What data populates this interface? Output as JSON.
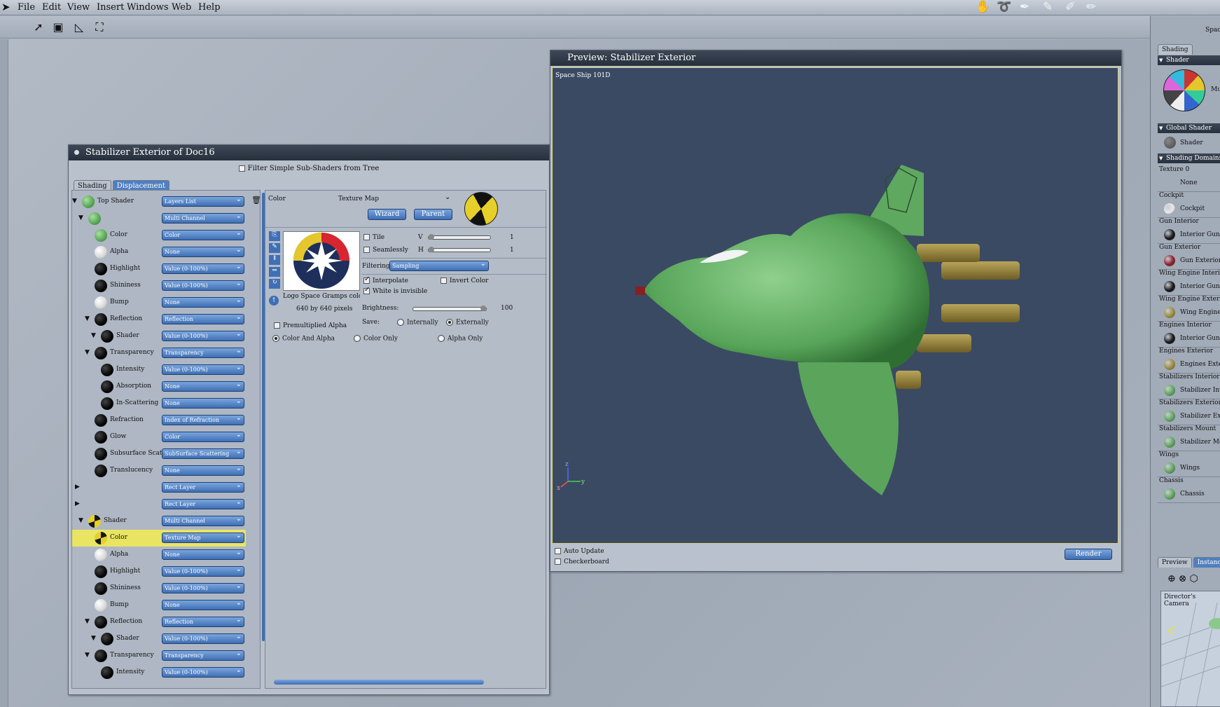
{
  "menu": {
    "logo_icon": "app-logo-icon",
    "items": [
      "File",
      "Edit",
      "View",
      "Insert",
      "Windows",
      "Web",
      "Help"
    ]
  },
  "toolbar": {
    "tools": [
      "arrow-select-icon",
      "box-select-icon",
      "polygon-select-icon",
      "frame-select-icon"
    ]
  },
  "top_right_label": "Spac",
  "shader_window": {
    "title": "Stabilizer Exterior of Doc16",
    "filter_label": "Filter Simple Sub-Shaders from Tree",
    "tabs": [
      "Shading",
      "Displacement"
    ],
    "tree": [
      {
        "label": "Top Shader",
        "value": "Layers List",
        "sphere": "green",
        "indent": 0
      },
      {
        "label": "",
        "value": "Multi Channel",
        "sphere": "green",
        "indent": 1
      },
      {
        "label": "Color",
        "value": "Color",
        "sphere": "green",
        "indent": 2
      },
      {
        "label": "Alpha",
        "value": "None",
        "sphere": "white",
        "indent": 2
      },
      {
        "label": "Highlight",
        "value": "Value (0-100%)",
        "sphere": "black",
        "indent": 2
      },
      {
        "label": "Shininess",
        "value": "Value (0-100%)",
        "sphere": "black",
        "indent": 2
      },
      {
        "label": "Bump",
        "value": "None",
        "sphere": "white",
        "indent": 2
      },
      {
        "label": "Reflection",
        "value": "Reflection",
        "sphere": "black",
        "indent": 2
      },
      {
        "label": "Shader",
        "value": "Value (0-100%)",
        "sphere": "black",
        "indent": 3
      },
      {
        "label": "Transparency",
        "value": "Transparency",
        "sphere": "black",
        "indent": 2
      },
      {
        "label": "Intensity",
        "value": "Value (0-100%)",
        "sphere": "black",
        "indent": 3
      },
      {
        "label": "Absorption",
        "value": "None",
        "sphere": "black",
        "indent": 3
      },
      {
        "label": "In-Scattering",
        "value": "None",
        "sphere": "black",
        "indent": 3
      },
      {
        "label": "Refraction",
        "value": "Index of Refraction",
        "sphere": "black",
        "indent": 2
      },
      {
        "label": "Glow",
        "value": "Color",
        "sphere": "black",
        "indent": 2
      },
      {
        "label": "Subsurface Scat",
        "value": "SubSurface Scattering",
        "sphere": "black",
        "indent": 2
      },
      {
        "label": "Translucency",
        "value": "None",
        "sphere": "black",
        "indent": 2
      },
      {
        "label": "",
        "value": "Rect Layer",
        "sphere": "",
        "indent": 0
      },
      {
        "label": "",
        "value": "Rect Layer",
        "sphere": "",
        "indent": 0
      },
      {
        "label": "Shader",
        "value": "Multi Channel",
        "sphere": "logo",
        "indent": 1
      },
      {
        "label": "Color",
        "value": "Texture Map",
        "sphere": "logo",
        "indent": 2,
        "selected": true
      },
      {
        "label": "Alpha",
        "value": "None",
        "sphere": "white",
        "indent": 2
      },
      {
        "label": "Highlight",
        "value": "Value (0-100%)",
        "sphere": "black",
        "indent": 2
      },
      {
        "label": "Shininess",
        "value": "Value (0-100%)",
        "sphere": "black",
        "indent": 2
      },
      {
        "label": "Bump",
        "value": "None",
        "sphere": "white",
        "indent": 2
      },
      {
        "label": "Reflection",
        "value": "Reflection",
        "sphere": "black",
        "indent": 2
      },
      {
        "label": "Shader",
        "value": "Value (0-100%)",
        "sphere": "black",
        "indent": 3
      },
      {
        "label": "Transparency",
        "value": "Transparency",
        "sphere": "black",
        "indent": 2
      },
      {
        "label": "Intensity",
        "value": "Value (0-100%)",
        "sphere": "black",
        "indent": 3
      }
    ],
    "editor": {
      "header_label": "Color",
      "type_label": "Texture Map",
      "wizard_button": "Wizard",
      "parent_button": "Parent",
      "image_name": "Logo Space Gramps color circ",
      "image_size": "640 by 640 pixels",
      "tile": "Tile",
      "seamlessly": "Seamlessly",
      "v_label": "V",
      "h_label": "H",
      "v_value": "1",
      "h_value": "1",
      "filtering_label": "Filtering:",
      "filtering_value": "Sampling",
      "interpolate": "Interpolate",
      "invert_color": "Invert Color",
      "white_invisible": "White is invisible",
      "brightness_label": "Brightness:",
      "brightness_value": "100",
      "brightness_level": 1.0,
      "save_label": "Save:",
      "save_internally": "Internally",
      "save_externally": "Externally",
      "premultiplied_alpha": "Premultiplied Alpha",
      "color_and_alpha": "Color And Alpha",
      "color_only": "Color Only",
      "alpha_only": "Alpha Only"
    }
  },
  "preview_window": {
    "title": "Preview: Stabilizer Exterior",
    "scene_label": "Space Ship 101D",
    "auto_update": "Auto Update",
    "checkerboard": "Checkerboard",
    "render_button": "Render",
    "axis_labels": [
      "z",
      "y",
      "x"
    ]
  },
  "side_panel": {
    "tab": "Shading",
    "shader_section": "Shader",
    "shader_name_partial": "Mu",
    "global_shader_section": "Global Shader",
    "global_shader_name": "Shader",
    "domains_section": "Shading Domains",
    "domains": [
      {
        "title": "Texture 0",
        "name": "None",
        "sphere": ""
      },
      {
        "title": "Cockpit",
        "name": "Cockpit",
        "sphere": "#e9e9e9"
      },
      {
        "title": "Gun Interior",
        "name": "Interior Gun a",
        "sphere": "#111111"
      },
      {
        "title": "Gun Exterior",
        "name": "Gun Exterior",
        "sphere": "#8d1a22"
      },
      {
        "title": "Wing Engine Interio",
        "name": "Interior Gun a",
        "sphere": "#111111"
      },
      {
        "title": "Wing Engine Exterior",
        "name": "Wing Engine",
        "sphere": "#9d8a3a"
      },
      {
        "title": "Engines Interior",
        "name": "Interior Gun a",
        "sphere": "#111111"
      },
      {
        "title": "Engines Exterior",
        "name": "Engines Exter",
        "sphere": "#9d8a3a"
      },
      {
        "title": "Stabilizers Interior",
        "name": "Stabilizer Inte",
        "sphere": "#5da55b"
      },
      {
        "title": "Stabilizers Exterior",
        "name": "Stabilizer Ext",
        "sphere": "#5da55b"
      },
      {
        "title": "Stabilizers Mount",
        "name": "Stabilizer Mo",
        "sphere": "#5da55b"
      },
      {
        "title": "Wings",
        "name": "Wings",
        "sphere": "#5da55b"
      },
      {
        "title": "Chassis",
        "name": "Chassis",
        "sphere": "#5da55b"
      }
    ],
    "bottom_tabs": [
      "Preview",
      "Instances"
    ],
    "camera_label": "Director's Camera"
  }
}
